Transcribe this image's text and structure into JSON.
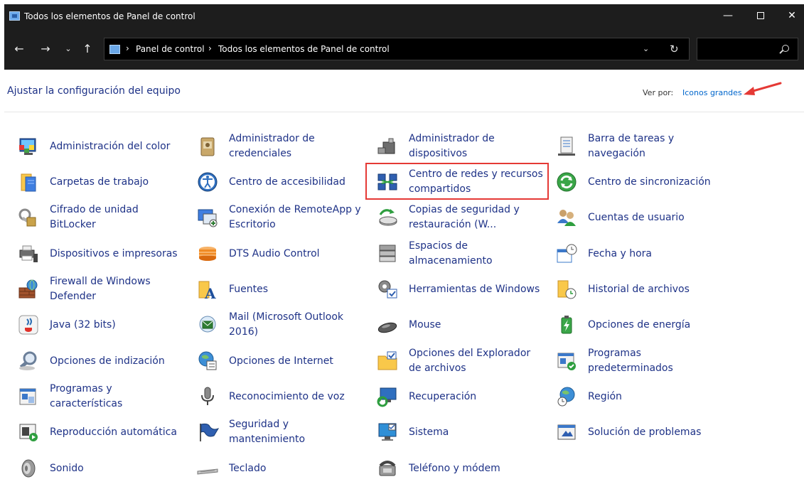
{
  "window": {
    "title": "Todos los elementos de Panel de control",
    "minimize_glyph": "—",
    "close_glyph": "✕"
  },
  "nav": {
    "back_glyph": "←",
    "forward_glyph": "→",
    "recent_glyph": "⌄",
    "up_glyph": "↑",
    "breadcrumbs": [
      "Panel de control",
      "Todos los elementos de Panel de control"
    ],
    "separator": "›",
    "dropdown_glyph": "⌄",
    "refresh_glyph": "↻",
    "search_placeholder": ""
  },
  "header": {
    "title": "Ajustar la configuración del equipo",
    "view_by_label": "Ver por:",
    "view_by_value": "Iconos grandes"
  },
  "accent": {
    "link_color": "#1e3287",
    "highlight_color": "#e53935"
  },
  "items": [
    {
      "label": "Administración del color",
      "icon": "color-management-icon"
    },
    {
      "label": "Administrador de credenciales",
      "icon": "credential-manager-icon"
    },
    {
      "label": "Administrador de dispositivos",
      "icon": "device-manager-icon"
    },
    {
      "label": "Barra de tareas y navegación",
      "icon": "taskbar-icon"
    },
    {
      "label": "Carpetas de trabajo",
      "icon": "work-folders-icon"
    },
    {
      "label": "Centro de accesibilidad",
      "icon": "ease-of-access-icon"
    },
    {
      "label": "Centro de redes y recursos compartidos",
      "icon": "network-sharing-icon"
    },
    {
      "label": "Centro de sincronización",
      "icon": "sync-center-icon"
    },
    {
      "label": "Cifrado de unidad BitLocker",
      "icon": "bitlocker-icon"
    },
    {
      "label": "Conexión de RemoteApp y Escritorio",
      "icon": "remoteapp-icon"
    },
    {
      "label": "Copias de seguridad y restauración (W...",
      "icon": "backup-restore-icon"
    },
    {
      "label": "Cuentas de usuario",
      "icon": "user-accounts-icon"
    },
    {
      "label": "Dispositivos e impresoras",
      "icon": "devices-printers-icon"
    },
    {
      "label": "DTS Audio Control",
      "icon": "dts-audio-icon"
    },
    {
      "label": "Espacios de almacenamiento",
      "icon": "storage-spaces-icon"
    },
    {
      "label": "Fecha y hora",
      "icon": "date-time-icon"
    },
    {
      "label": "Firewall de Windows Defender",
      "icon": "firewall-icon"
    },
    {
      "label": "Fuentes",
      "icon": "fonts-icon"
    },
    {
      "label": "Herramientas de Windows",
      "icon": "windows-tools-icon"
    },
    {
      "label": "Historial de archivos",
      "icon": "file-history-icon"
    },
    {
      "label": "Java (32 bits)",
      "icon": "java-icon"
    },
    {
      "label": "Mail (Microsoft Outlook 2016)",
      "icon": "mail-icon"
    },
    {
      "label": "Mouse",
      "icon": "mouse-icon"
    },
    {
      "label": "Opciones de energía",
      "icon": "power-options-icon"
    },
    {
      "label": "Opciones de indización",
      "icon": "indexing-options-icon"
    },
    {
      "label": "Opciones de Internet",
      "icon": "internet-options-icon"
    },
    {
      "label": "Opciones del Explorador de archivos",
      "icon": "explorer-options-icon"
    },
    {
      "label": "Programas predeterminados",
      "icon": "default-programs-icon"
    },
    {
      "label": "Programas y características",
      "icon": "programs-features-icon"
    },
    {
      "label": "Reconocimiento de voz",
      "icon": "speech-recognition-icon"
    },
    {
      "label": "Recuperación",
      "icon": "recovery-icon"
    },
    {
      "label": "Región",
      "icon": "region-icon"
    },
    {
      "label": "Reproducción automática",
      "icon": "autoplay-icon"
    },
    {
      "label": "Seguridad y mantenimiento",
      "icon": "security-maintenance-icon"
    },
    {
      "label": "Sistema",
      "icon": "system-icon"
    },
    {
      "label": "Solución de problemas",
      "icon": "troubleshooting-icon"
    },
    {
      "label": "Sonido",
      "icon": "sound-icon"
    },
    {
      "label": "Teclado",
      "icon": "keyboard-icon"
    },
    {
      "label": "Teléfono y módem",
      "icon": "phone-modem-icon"
    }
  ]
}
